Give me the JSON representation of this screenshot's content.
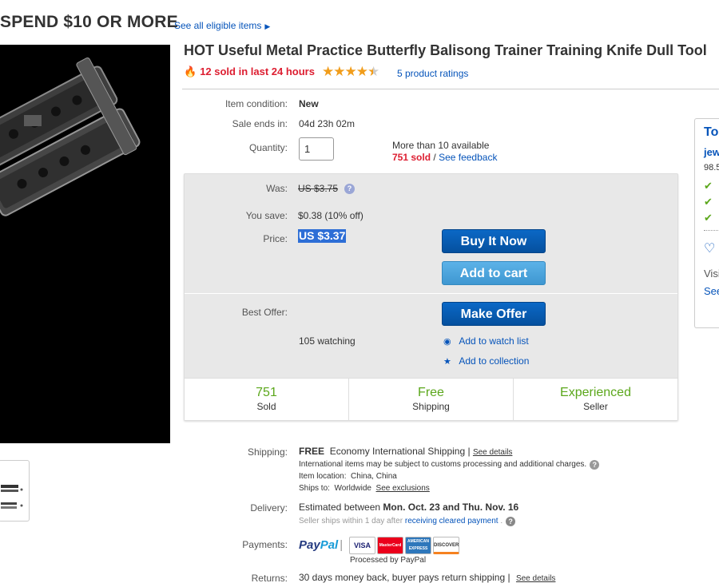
{
  "promo": {
    "text": "SPEND $10 OR MORE",
    "link": "See all eligible items"
  },
  "listing": {
    "title": "HOT Useful Metal Practice Butterfly Balisong Trainer Training Knife Dull Tool",
    "sold_24h": "12 sold in last 24 hours",
    "rating_stars": 4.5,
    "ratings_link": "5 product ratings"
  },
  "details": {
    "condition_label": "Item condition:",
    "condition_value": "New",
    "sale_ends_label": "Sale ends in:",
    "sale_ends_value": "04d 23h 02m",
    "quantity_label": "Quantity:",
    "quantity_value": "1",
    "available_text": "More than 10 available",
    "sold_count": "751 sold",
    "separator": "/",
    "feedback_link": "See feedback"
  },
  "pricing": {
    "was_label": "Was:",
    "was_value": "US $3.75",
    "save_label": "You save:",
    "save_value": "$0.38 (10% off)",
    "price_label": "Price:",
    "price_value": "US $3.37",
    "buy_now": "Buy It Now",
    "add_to_cart": "Add to cart",
    "best_offer_label": "Best Offer:",
    "make_offer": "Make Offer",
    "watching": "105 watching",
    "add_watch": "Add to watch list",
    "add_collection": "Add to collection"
  },
  "stats": [
    {
      "value": "751",
      "label": "Sold"
    },
    {
      "value": "Free",
      "label": "Shipping"
    },
    {
      "value": "Experienced",
      "label": "Seller"
    }
  ],
  "seller_card": {
    "title": "To",
    "name": "jew",
    "score": "98.5",
    "visit": "Visi",
    "see": "See"
  },
  "shipping": {
    "label": "Shipping:",
    "free": "FREE",
    "method": "Economy International Shipping",
    "see_details": "See details",
    "customs_note": "International items may be subject to customs processing and additional charges.",
    "location_label": "Item location:",
    "location": "China, China",
    "ships_to_label": "Ships to:",
    "ships_to": "Worldwide",
    "see_exclusions": "See exclusions"
  },
  "delivery": {
    "label": "Delivery:",
    "prefix": "Estimated between",
    "range": "Mon. Oct. 23 and Thu. Nov. 16",
    "note_prefix": "Seller ships within 1 day after",
    "note_link": "receiving cleared payment",
    "note_suffix": "."
  },
  "payments": {
    "label": "Payments:",
    "paypal_a": "Pay",
    "paypal_b": "Pal",
    "cards": [
      "VISA",
      "MasterCard",
      "AMERICAN EXPRESS",
      "DISCOVER"
    ],
    "processed": "Processed by PayPal"
  },
  "returns": {
    "label": "Returns:",
    "text": "30 days money back, buyer pays return shipping",
    "see_details": "See details"
  },
  "colors": {
    "accent_blue": "#0654ba",
    "sold_red": "#dd1e31",
    "stat_green": "#5ba71b",
    "star_orange": "#f19d1b"
  }
}
